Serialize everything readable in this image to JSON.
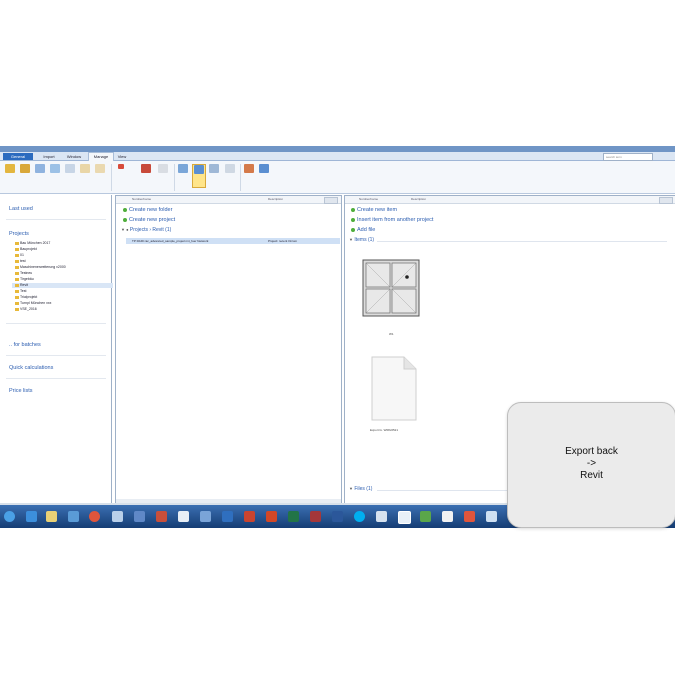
{
  "ribbon": {
    "tabs": [
      "General",
      "Import",
      "Window",
      "Manage",
      "View"
    ],
    "active_tab": "Manage",
    "search_placeholder": "search term"
  },
  "left_panel": {
    "last_used": "Last used",
    "projects": "Projects",
    "tree": [
      "Bau München 2017",
      "Bauprojekt",
      "01",
      "test",
      "Maschinenerweiterung v2000",
      "Testneu",
      "Tirgebäu",
      "Revit",
      "Test",
      "Trialprojekt",
      "Turnpl München xxx",
      "VSE_2016"
    ],
    "selected_item": "Revit",
    "for_batches": ".. for batches",
    "quick_calc": "Quick calculations",
    "price_lists": "Price lists"
  },
  "middle_panel": {
    "col_name": "Number/name",
    "col_desc": "Description",
    "create_folder": "Create new folder",
    "create_project": "Create new project",
    "breadcrumb": "Projects › Revit (1)",
    "row_name": "TP RAID rac_advanced_sample_project.rvt_fuer Network",
    "row_desc": "Project: recent Orcom"
  },
  "right_panel": {
    "col_name": "Number/name",
    "col_desc": "Description",
    "create_item": "Create new item",
    "insert_item": "Insert item from another project",
    "add_file": "Add file",
    "items_section": "Items (1)",
    "files_section": "Files (1)",
    "item_caption": "W1",
    "file_caption": "Export fo. W08x6521"
  },
  "overlay": {
    "line1": "Export back",
    "line2": "->",
    "line3": "Revit"
  },
  "colors": {
    "accent": "#2b5db0",
    "titlebar": "#6f95c6",
    "taskbar": "#1e4f8e"
  }
}
